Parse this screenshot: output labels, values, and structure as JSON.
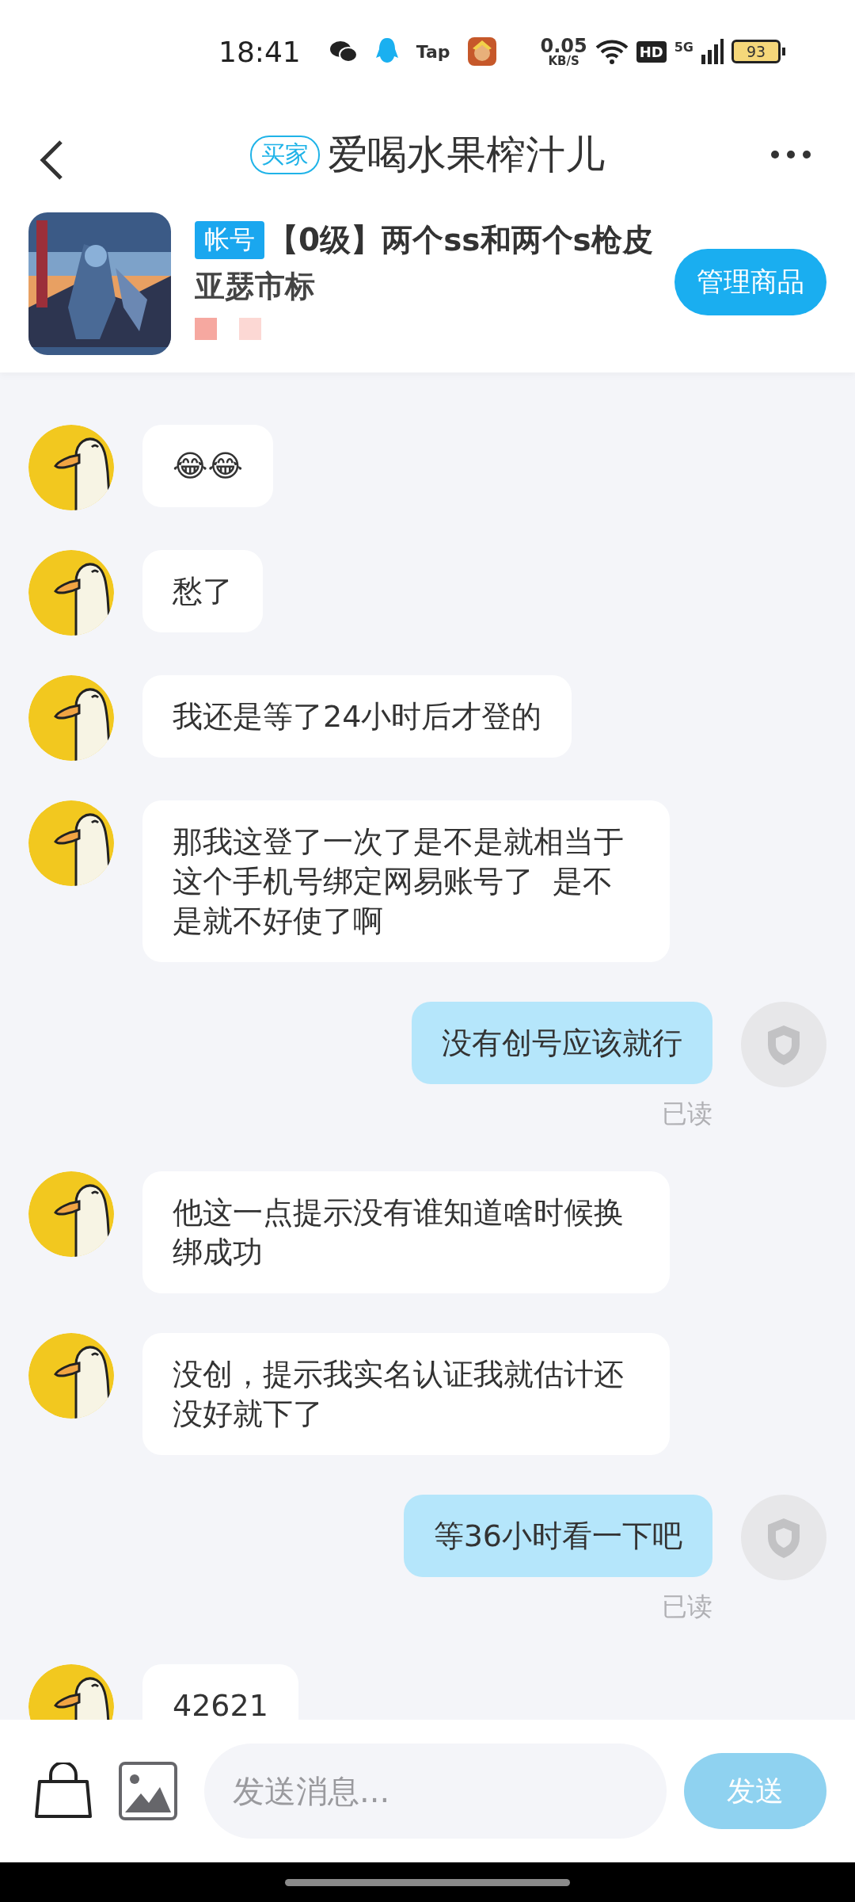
{
  "status_bar": {
    "time": "18:41",
    "apps": [
      {
        "kind": "wechat"
      },
      {
        "kind": "qq"
      },
      {
        "kind": "tap",
        "label": "Tap"
      },
      {
        "kind": "game"
      }
    ],
    "net_speed": "0.05",
    "net_unit": "KB/S",
    "hd": "HD",
    "network": "5G",
    "battery": "93"
  },
  "header": {
    "role_badge": "买家",
    "title": "爱喝水果榨汁儿"
  },
  "product": {
    "tag": "帐号",
    "title": "【0级】两个ss和两个s枪皮",
    "subtitle": "亚瑟市标",
    "button": "管理商品"
  },
  "messages": [
    {
      "kind": "incoming",
      "text": "😂😂"
    },
    {
      "kind": "incoming",
      "text": "愁了"
    },
    {
      "kind": "incoming",
      "text": "我还是等了24小时后才登的"
    },
    {
      "kind": "incoming",
      "text": "那我这登了一次了是不是就相当于这个手机号绑定网易账号了  是不是就不好使了啊"
    },
    {
      "kind": "outgoing",
      "text": "没有创号应该就行",
      "status": "已读"
    },
    {
      "kind": "incoming",
      "text": "他这一点提示没有谁知道啥时候换绑成功"
    },
    {
      "kind": "incoming",
      "text": "没创，提示我实名认证我就估计还没好就下了"
    },
    {
      "kind": "outgoing",
      "text": "等36小时看一下吧",
      "status": "已读"
    },
    {
      "kind": "incoming",
      "text": "42621"
    }
  ],
  "input": {
    "placeholder": "发送消息...",
    "send": "发送",
    "send_disabled": true
  }
}
